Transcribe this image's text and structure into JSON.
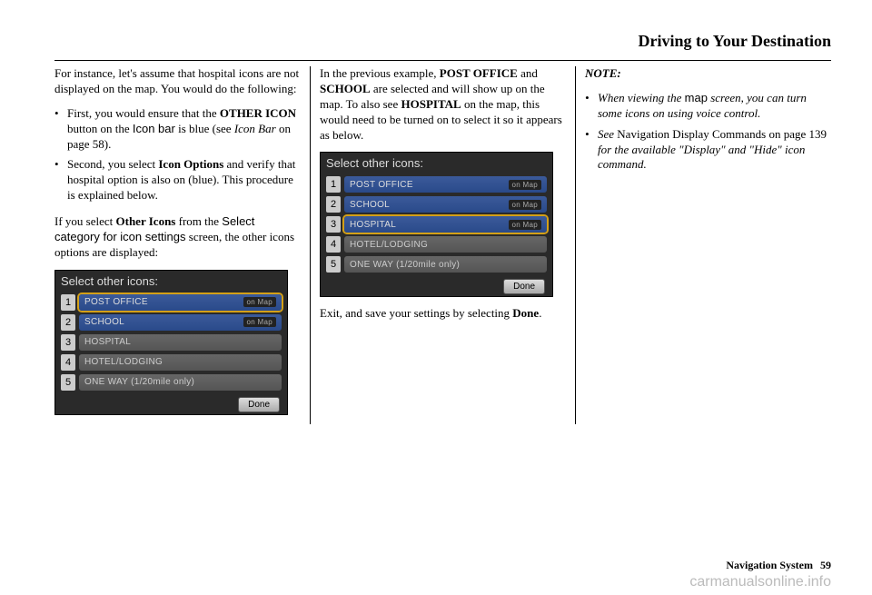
{
  "header": "Driving to Your Destination",
  "col1": {
    "intro": "For instance, let's assume that hospital icons are not displayed on the map. You would do the following:",
    "li1_a": "First, you would ensure that the ",
    "li1_b": "OTHER ICON",
    "li1_c": " button on the ",
    "li1_d": "Icon bar",
    "li1_e": " is blue (see ",
    "li1_f": "Icon Bar",
    "li1_g": " on page 58).",
    "li2_a": "Second, you select ",
    "li2_b": "Icon Options",
    "li2_c": " and verify that hospital option is also on (blue). This procedure is explained below.",
    "p2_a": "If you select ",
    "p2_b": "Other Icons",
    "p2_c": " from the ",
    "p2_d": "Select category for icon settings",
    "p2_e": " screen, the other icons options are displayed:"
  },
  "col2": {
    "p1_a": "In the previous example, ",
    "p1_b": "POST OFFICE",
    "p1_c": " and ",
    "p1_d": "SCHOOL",
    "p1_e": " are selected and will show up on the map. To also see ",
    "p1_f": "HOSPITAL",
    "p1_g": " on the map, this would need to be turned on to select it so it appears as below.",
    "p2_a": "Exit, and save your settings by selecting ",
    "p2_b": "Done",
    "p2_c": "."
  },
  "col3": {
    "note": "NOTE:",
    "li1_a": "When viewing the ",
    "li1_b": "map",
    "li1_c": " screen, you can turn some icons on using voice control.",
    "li2_a": "See ",
    "li2_b": "Navigation Display Commands on page 139",
    "li2_c": " for the available \"Display\" and \"Hide\" icon command."
  },
  "screens": {
    "title": "Select other icons:",
    "row1": "POST OFFICE",
    "row2": "SCHOOL",
    "row3": "HOSPITAL",
    "row4": "HOTEL/LODGING",
    "row5": "ONE WAY (1/20mile only)",
    "onmap": "on Map",
    "done": "Done",
    "n1": "1",
    "n2": "2",
    "n3": "3",
    "n4": "4",
    "n5": "5"
  },
  "footer": {
    "label": "Navigation System",
    "page": "59"
  },
  "watermark": "carmanualsonline.info"
}
